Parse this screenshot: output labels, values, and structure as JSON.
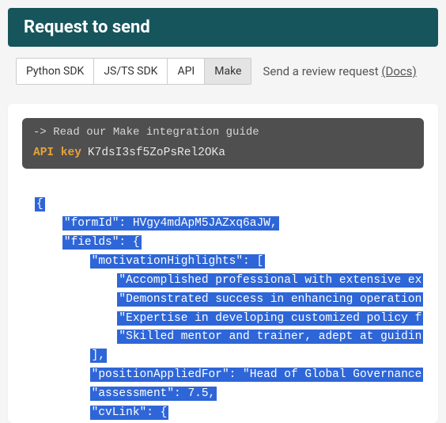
{
  "header": {
    "title": "Request to send"
  },
  "tabs": {
    "items": [
      "Python SDK",
      "JS/TS SDK",
      "API",
      "Make"
    ],
    "activeIndex": 3
  },
  "note": {
    "text": "Send a review request ",
    "linkLabel": "(Docs)"
  },
  "guide": {
    "text": "-> Read our Make integration guide"
  },
  "apiKey": {
    "label": "API key",
    "value": "K7dsI3sf5ZoPsRel2OKa"
  },
  "code": {
    "lines": [
      {
        "indent": 0,
        "text": "{",
        "tail": ""
      },
      {
        "indent": 1,
        "text": "\"formId\": HVgy4mdApM5JAZxq6aJW,",
        "tail": ""
      },
      {
        "indent": 1,
        "text": "\"fields\": {",
        "tail": ""
      },
      {
        "indent": 2,
        "text": "\"motivationHighlights\": [",
        "tail": ""
      },
      {
        "indent": 3,
        "text": "\"Accomplished professional with extensive ex",
        "tail": ""
      },
      {
        "indent": 3,
        "text": "\"Demonstrated success in enhancing operation",
        "tail": ""
      },
      {
        "indent": 3,
        "text": "\"Expertise in developing customized policy f",
        "tail": ""
      },
      {
        "indent": 3,
        "text": "\"Skilled mentor and trainer, adept at guidin",
        "tail": ""
      },
      {
        "indent": 2,
        "text": "],",
        "tail": ""
      },
      {
        "indent": 2,
        "text": "\"positionAppliedFor\": \"Head of Global Governance",
        "tail": ""
      },
      {
        "indent": 2,
        "text": "\"assessment\": 7.5,",
        "tail": ""
      },
      {
        "indent": 2,
        "text": "\"cvLink\": {",
        "tail": ""
      }
    ]
  }
}
